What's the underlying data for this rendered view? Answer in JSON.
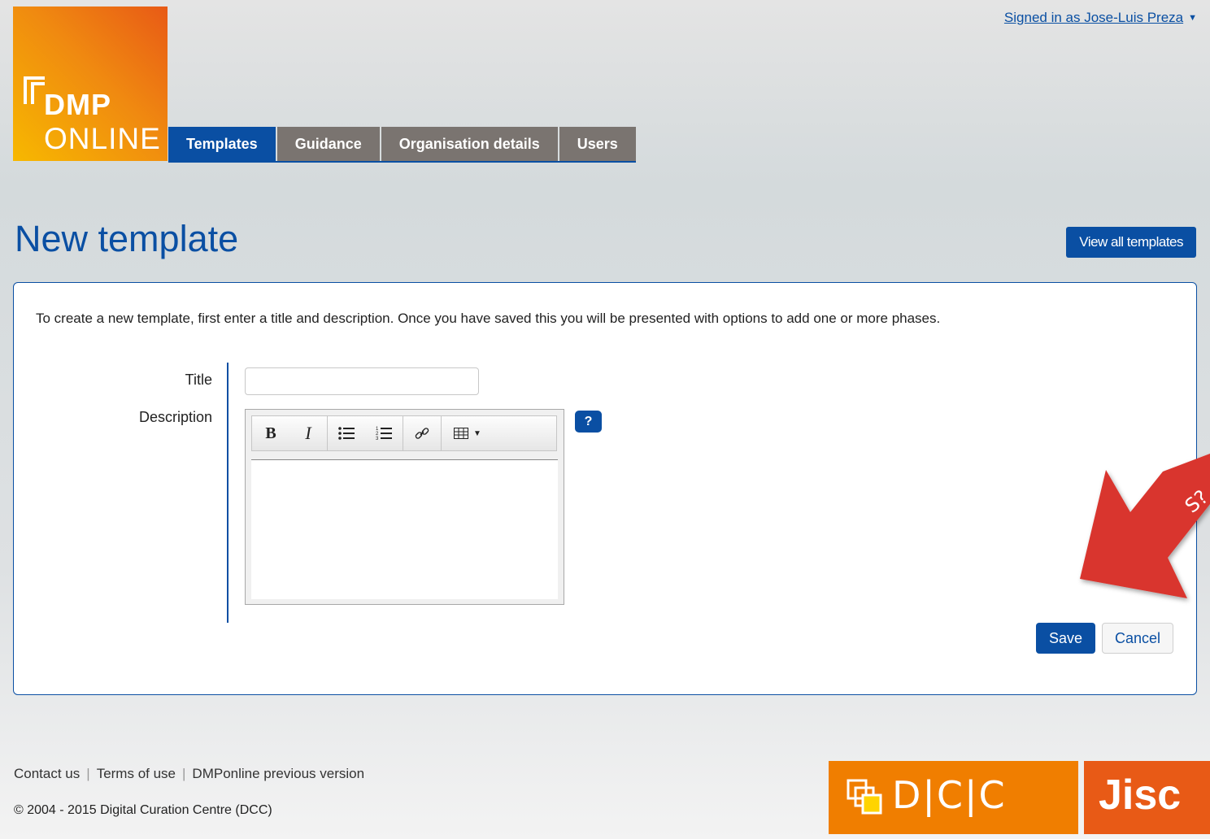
{
  "header": {
    "logo_top": "DMP",
    "logo_bottom": "ONLINE",
    "signed_in": "Signed in as Jose-Luis Preza",
    "tabs": [
      {
        "label": "Templates",
        "active": true
      },
      {
        "label": "Guidance",
        "active": false
      },
      {
        "label": "Organisation details",
        "active": false
      },
      {
        "label": "Users",
        "active": false
      }
    ]
  },
  "page": {
    "title": "New template",
    "view_all_button": "View all templates",
    "intro": "To create a new template, first enter a title and description. Once you have saved this you will be presented with options to add one or more phases.",
    "form": {
      "title_label": "Title",
      "title_value": "",
      "description_label": "Description",
      "help_button": "?",
      "toolbar": {
        "bold": "B",
        "italic": "I"
      }
    },
    "save_button": "Save",
    "cancel_button": "Cancel",
    "annotation_text": "S?"
  },
  "footer": {
    "links": [
      "Contact us",
      "Terms of use",
      "DMPonline previous version"
    ],
    "copyright": "© 2004 - 2015 Digital Curation Centre (DCC)",
    "dcc_logo": "D|C|C",
    "jisc_logo": "Jisc"
  },
  "colors": {
    "primary": "#0a4fa3",
    "tab_inactive": "#7a7470",
    "dcc_orange": "#f07e00",
    "jisc_orange": "#e85a16",
    "annotation_red": "#d9352e"
  }
}
